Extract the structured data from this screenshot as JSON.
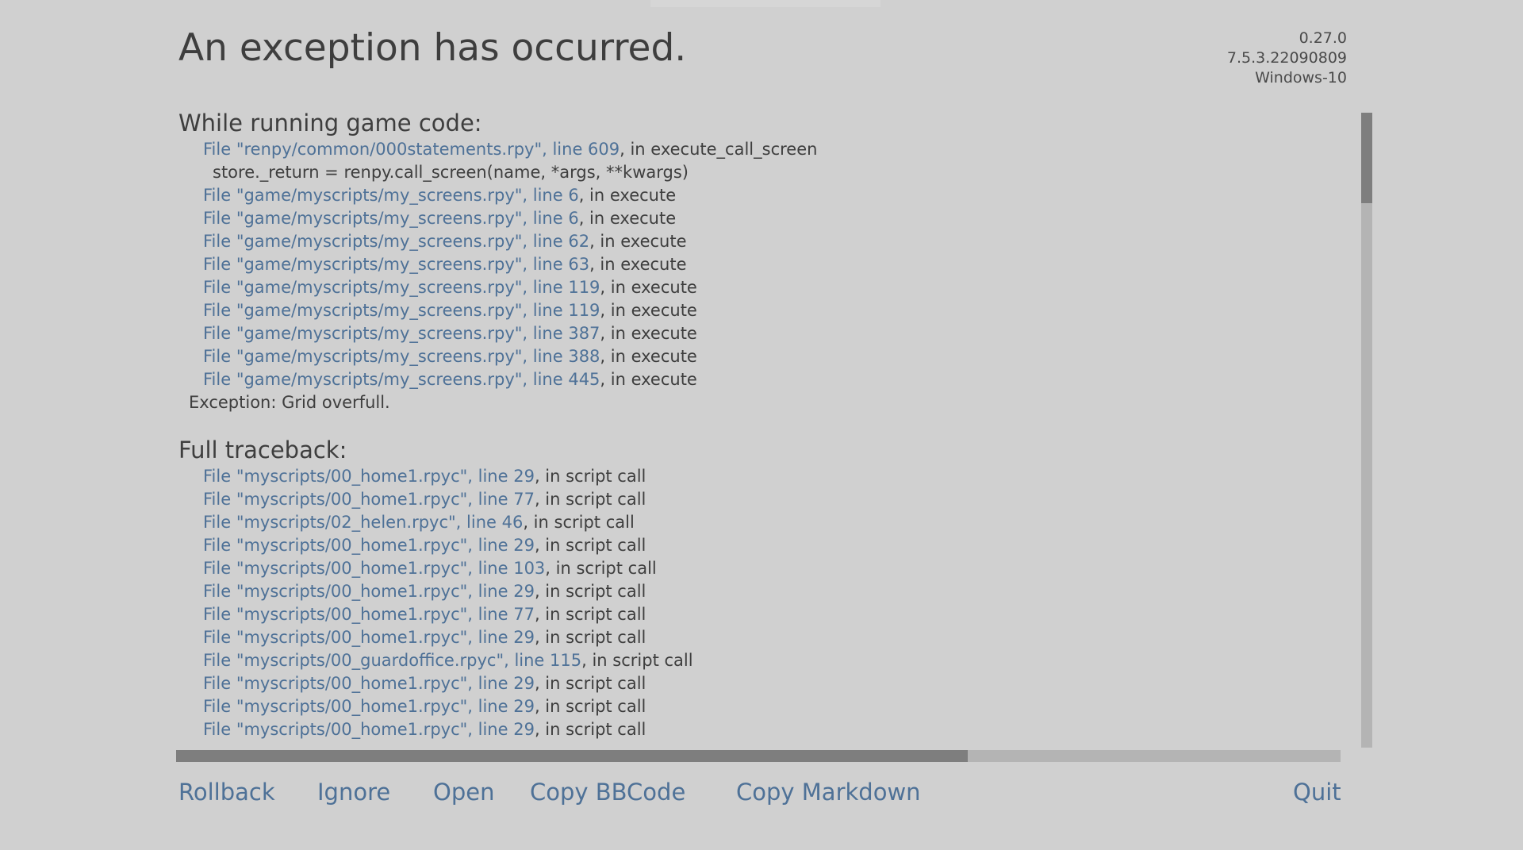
{
  "window": {
    "background_color": "#d0d0d0",
    "text_color": "#3e3e3e",
    "link_color": "#4e7197"
  },
  "header": {
    "title": "An exception has occurred.",
    "version": {
      "game_version": "0.27.0",
      "renpy_version": "7.5.3.22090809",
      "platform": "Windows-10"
    }
  },
  "traceback": {
    "game_code_heading": "While running game code:",
    "game_code_lines": [
      {
        "type": "file",
        "prefix": "File ",
        "file": "\"renpy/common/000statements.rpy\"",
        "sep": ", ",
        "line": "line 609",
        "suffix": ", in execute_call_screen"
      },
      {
        "type": "code",
        "text": "store._return = renpy.call_screen(name, *args, **kwargs)"
      },
      {
        "type": "file",
        "prefix": "File ",
        "file": "\"game/myscripts/my_screens.rpy\"",
        "sep": ", ",
        "line": "line 6",
        "suffix": ", in execute"
      },
      {
        "type": "file",
        "prefix": "File ",
        "file": "\"game/myscripts/my_screens.rpy\"",
        "sep": ", ",
        "line": "line 6",
        "suffix": ", in execute"
      },
      {
        "type": "file",
        "prefix": "File ",
        "file": "\"game/myscripts/my_screens.rpy\"",
        "sep": ", ",
        "line": "line 62",
        "suffix": ", in execute"
      },
      {
        "type": "file",
        "prefix": "File ",
        "file": "\"game/myscripts/my_screens.rpy\"",
        "sep": ", ",
        "line": "line 63",
        "suffix": ", in execute"
      },
      {
        "type": "file",
        "prefix": "File ",
        "file": "\"game/myscripts/my_screens.rpy\"",
        "sep": ", ",
        "line": "line 119",
        "suffix": ", in execute"
      },
      {
        "type": "file",
        "prefix": "File ",
        "file": "\"game/myscripts/my_screens.rpy\"",
        "sep": ", ",
        "line": "line 119",
        "suffix": ", in execute"
      },
      {
        "type": "file",
        "prefix": "File ",
        "file": "\"game/myscripts/my_screens.rpy\"",
        "sep": ", ",
        "line": "line 387",
        "suffix": ", in execute"
      },
      {
        "type": "file",
        "prefix": "File ",
        "file": "\"game/myscripts/my_screens.rpy\"",
        "sep": ", ",
        "line": "line 388",
        "suffix": ", in execute"
      },
      {
        "type": "file",
        "prefix": "File ",
        "file": "\"game/myscripts/my_screens.rpy\"",
        "sep": ", ",
        "line": "line 445",
        "suffix": ", in execute"
      }
    ],
    "exception_message": "Exception: Grid overfull.",
    "full_traceback_heading": "Full traceback:",
    "full_traceback_lines": [
      {
        "type": "file",
        "prefix": "File ",
        "file": "\"myscripts/00_home1.rpyc\"",
        "sep": ", ",
        "line": "line 29",
        "suffix": ", in script call"
      },
      {
        "type": "file",
        "prefix": "File ",
        "file": "\"myscripts/00_home1.rpyc\"",
        "sep": ", ",
        "line": "line 77",
        "suffix": ", in script call"
      },
      {
        "type": "file",
        "prefix": "File ",
        "file": "\"myscripts/02_helen.rpyc\"",
        "sep": ", ",
        "line": "line 46",
        "suffix": ", in script call"
      },
      {
        "type": "file",
        "prefix": "File ",
        "file": "\"myscripts/00_home1.rpyc\"",
        "sep": ", ",
        "line": "line 29",
        "suffix": ", in script call"
      },
      {
        "type": "file",
        "prefix": "File ",
        "file": "\"myscripts/00_home1.rpyc\"",
        "sep": ", ",
        "line": "line 103",
        "suffix": ", in script call"
      },
      {
        "type": "file",
        "prefix": "File ",
        "file": "\"myscripts/00_home1.rpyc\"",
        "sep": ", ",
        "line": "line 29",
        "suffix": ", in script call"
      },
      {
        "type": "file",
        "prefix": "File ",
        "file": "\"myscripts/00_home1.rpyc\"",
        "sep": ", ",
        "line": "line 77",
        "suffix": ", in script call"
      },
      {
        "type": "file",
        "prefix": "File ",
        "file": "\"myscripts/00_home1.rpyc\"",
        "sep": ", ",
        "line": "line 29",
        "suffix": ", in script call"
      },
      {
        "type": "file",
        "prefix": "File ",
        "file": "\"myscripts/00_guardoffice.rpyc\"",
        "sep": ", ",
        "line": "line 115",
        "suffix": ", in script call"
      },
      {
        "type": "file",
        "prefix": "File ",
        "file": "\"myscripts/00_home1.rpyc\"",
        "sep": ", ",
        "line": "line 29",
        "suffix": ", in script call"
      },
      {
        "type": "file",
        "prefix": "File ",
        "file": "\"myscripts/00_home1.rpyc\"",
        "sep": ", ",
        "line": "line 29",
        "suffix": ", in script call"
      },
      {
        "type": "file",
        "prefix": "File ",
        "file": "\"myscripts/00_home1.rpyc\"",
        "sep": ", ",
        "line": "line 29",
        "suffix": ", in script call"
      }
    ]
  },
  "scrollbars": {
    "vertical": {
      "thumb_position_percent": 0,
      "thumb_size_percent": 14
    },
    "horizontal": {
      "thumb_position_percent": 0,
      "thumb_size_percent": 68
    }
  },
  "footer": {
    "buttons": [
      {
        "key": "rollback",
        "label": "Rollback"
      },
      {
        "key": "ignore",
        "label": "Ignore"
      },
      {
        "key": "open",
        "label": "Open"
      },
      {
        "key": "copy_bbcode",
        "label": "Copy BBCode"
      },
      {
        "key": "copy_markdown",
        "label": "Copy Markdown"
      },
      {
        "key": "quit",
        "label": "Quit"
      }
    ]
  }
}
